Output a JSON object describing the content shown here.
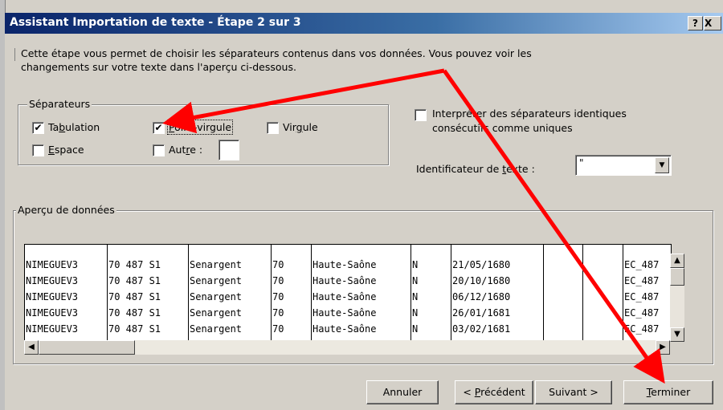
{
  "window": {
    "title": "Assistant Importation de texte - Étape 2 sur 3",
    "help_label": "?",
    "close_label": "X"
  },
  "intro_text_line1": "Cette étape vous permet de choisir les séparateurs contenus dans vos données. Vous pouvez voir les",
  "intro_text_line2": "changements sur votre texte dans l'aperçu ci-dessous.",
  "separators": {
    "legend": "Séparateurs",
    "tab": {
      "label_prefix": "Ta",
      "label_u": "b",
      "label_suffix": "ulation",
      "checked": true,
      "mark": "✔"
    },
    "semicolon": {
      "label_prefix": "",
      "label_u": "P",
      "label_suffix": "oint-virgule",
      "checked": true,
      "mark": "✔"
    },
    "comma": {
      "label_prefix": "Vir",
      "label_u": "g",
      "label_suffix": "ule",
      "checked": false,
      "mark": ""
    },
    "space": {
      "label_prefix": "",
      "label_u": "E",
      "label_suffix": "space",
      "checked": false,
      "mark": ""
    },
    "other": {
      "label_prefix": "Aut",
      "label_u": "r",
      "label_suffix": "e :",
      "checked": false,
      "mark": "",
      "value": ""
    }
  },
  "consecutive": {
    "line1": "Interpréter des séparateurs identiques",
    "line2": "consécutifs comme uniques",
    "checked": false
  },
  "text_qualifier": {
    "label_prefix": "Identificateur de ",
    "label_u": "t",
    "label_suffix": "exte :",
    "value": "\"",
    "dropdown_glyph": "▼"
  },
  "preview": {
    "legend": "Aperçu de données",
    "rows": [
      [
        "NIMEGUEV3",
        "70 487 S1",
        "Senargent",
        "70",
        "Haute-Saône",
        "N",
        "21/05/1680",
        "",
        "",
        "EC_487"
      ],
      [
        "NIMEGUEV3",
        "70 487 S1",
        "Senargent",
        "70",
        "Haute-Saône",
        "N",
        "20/10/1680",
        "",
        "",
        "EC_487"
      ],
      [
        "NIMEGUEV3",
        "70 487 S1",
        "Senargent",
        "70",
        "Haute-Saône",
        "N",
        "06/12/1680",
        "",
        "",
        "EC_487"
      ],
      [
        "NIMEGUEV3",
        "70 487 S1",
        "Senargent",
        "70",
        "Haute-Saône",
        "N",
        "26/01/1681",
        "",
        "",
        "EC_487"
      ],
      [
        "NIMEGUEV3",
        "70 487 S1",
        "Senargent",
        "70",
        "Haute-Saône",
        "N",
        "03/02/1681",
        "",
        "",
        "EC_487"
      ]
    ],
    "scroll_up": "▲",
    "scroll_down": "▼",
    "scroll_left": "◀",
    "scroll_right": "▶"
  },
  "buttons": {
    "cancel": "Annuler",
    "prev_prefix": "< ",
    "prev_u": "P",
    "prev_suffix": "récédent",
    "next": "Suivant >",
    "finish_u": "T",
    "finish_suffix": "erminer"
  },
  "colors": {
    "annotation_arrow": "#ff0000",
    "title_start": "#0a246a",
    "title_end": "#a6caf0"
  }
}
